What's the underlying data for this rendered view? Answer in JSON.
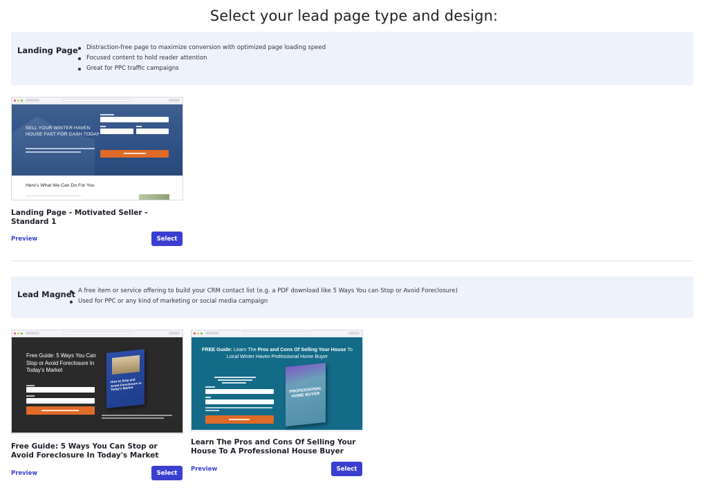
{
  "page": {
    "title": "Select your lead page type and design:"
  },
  "sections": [
    {
      "title": "Landing Page",
      "bullets": [
        "Distraction-free page to maximize conversion with optimized page loading speed",
        "Focused content to hold reader attention",
        "Great for PPC traffic campaigns"
      ],
      "cards": [
        {
          "title": "Landing Page - Motivated Seller - Standard 1",
          "preview": "Preview",
          "select": "Select",
          "thumb": {
            "headline_1": "SELL YOUR WINTER HAVEN",
            "headline_2": "HOUSE FAST FOR CASH TODAY",
            "lower_heading": "Here’s What We Can Do For You"
          }
        }
      ]
    },
    {
      "title": "Lead Magnet",
      "bullets": [
        "A free item or service offering to build your CRM contact list (e.g. a PDF download like 5 Ways You can Stop or Avoid Foreclosure)",
        "Used for PPC or any kind of marketing or social media campaign"
      ],
      "cards": [
        {
          "title": "Free Guide: 5 Ways You Can Stop or Avoid Foreclosure In Today's Market",
          "preview": "Preview",
          "select": "Select",
          "thumb": {
            "headline": "Free Guide: 5 Ways You Can Stop or Avoid Foreclosure In Today’s Market",
            "book_title": "How to Stop and Avoid Foreclosure in Today’s Market"
          }
        },
        {
          "title": "Learn The Pros and Cons Of Selling Your House To A Professional House Buyer",
          "preview": "Preview",
          "select": "Select",
          "thumb": {
            "headline_bold_1": "FREE Guide:",
            "headline_normal_1": " Learn The ",
            "headline_bold_2": "Pros and Cons Of Selling Your House",
            "headline_normal_2": " To Local Winter Haven Professional Home Buyer",
            "book_title": "PROFESSIONAL HOME BUYER"
          }
        }
      ]
    }
  ],
  "colors": {
    "accent": "#3a3fd0",
    "info_box_bg": "#eef2fd",
    "cta_orange": "#e06a28",
    "teal": "#136b88"
  }
}
